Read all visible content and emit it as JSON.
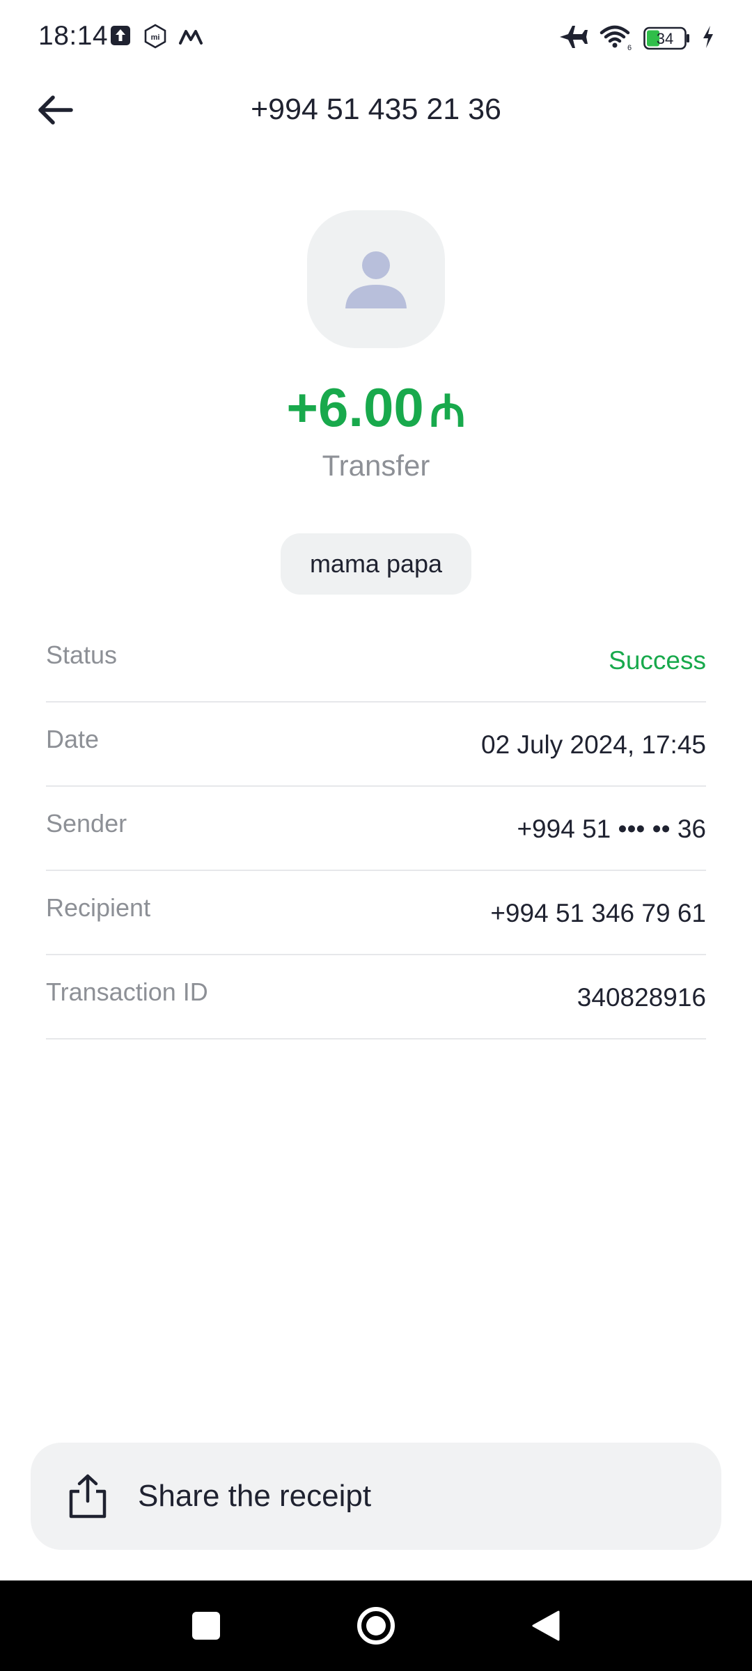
{
  "status_bar": {
    "time": "18:14",
    "battery_level": "34",
    "icons": [
      "upload-notification-icon",
      "mi-icon",
      "m-app-icon",
      "airplane-icon",
      "wifi-icon",
      "battery-icon",
      "charging-icon"
    ]
  },
  "header": {
    "title": "+994 51 435 21 36",
    "back_icon": "arrow-left-icon"
  },
  "transaction": {
    "amount": "+6.00",
    "currency_symbol": "₼",
    "type": "Transfer",
    "note": "mama papa"
  },
  "details": [
    {
      "label": "Status",
      "value": "Success"
    },
    {
      "label": "Date",
      "value": "02 July 2024, 17:45"
    },
    {
      "label": "Sender",
      "value": "+994 51 ••• •• 36"
    },
    {
      "label": "Recipient",
      "value": "+994 51 346 79 61"
    },
    {
      "label": "Transaction ID",
      "value": "340828916"
    }
  ],
  "share": {
    "label": "Share the receipt",
    "icon": "share-icon"
  },
  "colors": {
    "accent_green": "#18a94c",
    "text_primary": "#1f2230",
    "text_secondary": "#8d9096",
    "surface": "#eff1f2",
    "avatar_glyph": "#b8bfdb"
  },
  "nav_bar": {
    "buttons": [
      "recents-square-icon",
      "home-circle-icon",
      "back-triangle-icon"
    ]
  }
}
